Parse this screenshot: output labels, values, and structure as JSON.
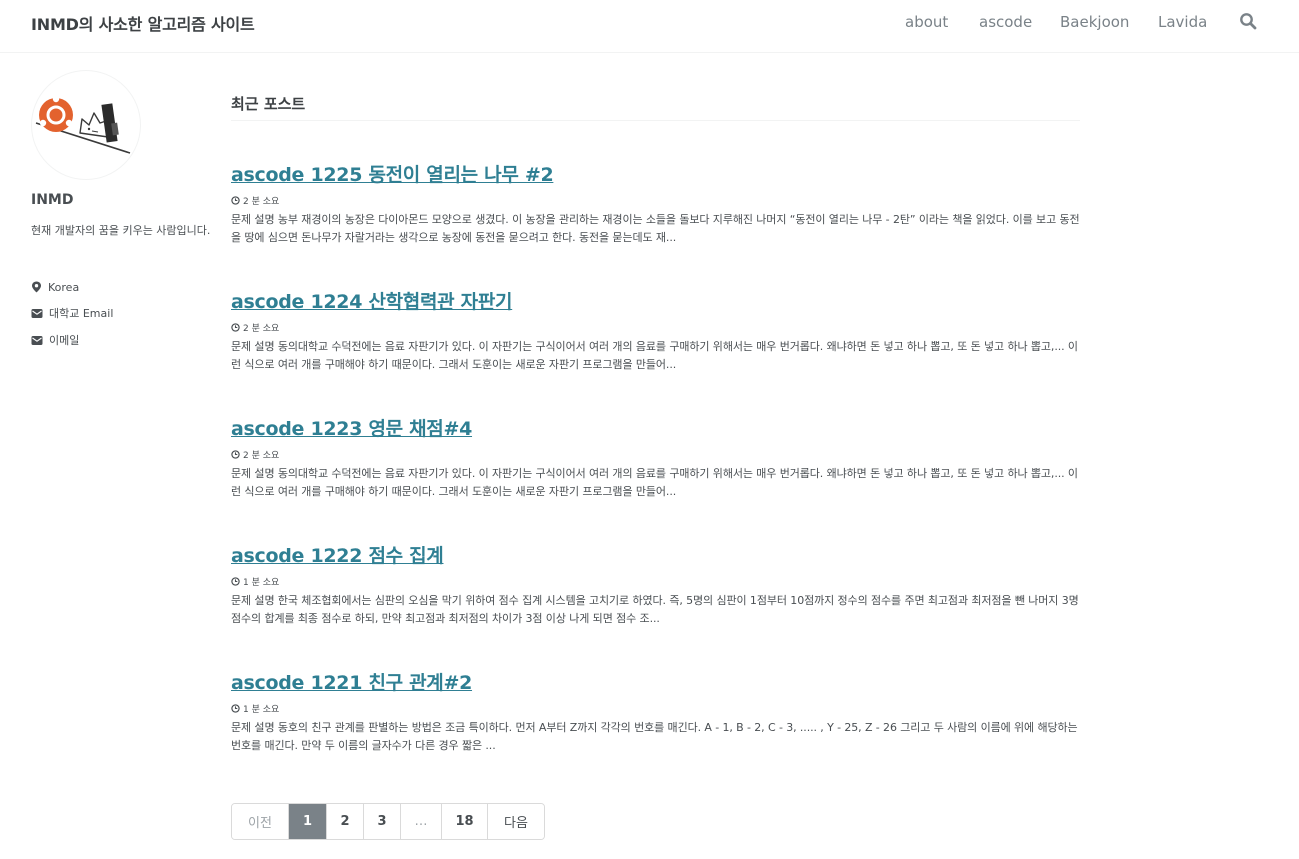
{
  "masthead": {
    "site_title": "INMD의 사소한 알고리즘 사이트",
    "nav": [
      "about",
      "ascode",
      "Baekjoon",
      "Lavida"
    ]
  },
  "sidebar": {
    "author_name": "INMD",
    "bio": "현재 개발자의 꿈을 키우는 사람입니다.",
    "links": [
      "Korea",
      "대학교 Email",
      "이메일"
    ]
  },
  "main": {
    "page_title": "최근 포스트",
    "posts": [
      {
        "title": "ascode 1225 동전이 열리는 나무 #2",
        "read_time": "2 분 소요",
        "excerpt": "문제 설명 농부 재경이의 농장은 다이아몬드 모양으로 생겼다. 이 농장을 관리하는 재경이는 소들을 돌보다 지루해진 나머지 “동전이 열리는 나무 - 2탄” 이라는 책을 읽었다. 이를 보고 동전을 땅에 심으면 돈나무가 자랄거라는 생각으로 농장에 동전을 묻으려고 한다. 동전을 묻는데도 재..."
      },
      {
        "title": "ascode 1224 산학협력관 자판기",
        "read_time": "2 분 소요",
        "excerpt": "문제 설명 동의대학교 수덕전에는 음료 자판기가 있다. 이 자판기는 구식이어서 여러 개의 음료를 구매하기 위해서는 매우 번거롭다. 왜냐하면 돈 넣고 하나 뽑고, 또 돈 넣고 하나 뽑고,... 이런 식으로 여러 개를 구매해야 하기 때문이다. 그래서 도훈이는 새로운 자판기 프로그램을 만들어..."
      },
      {
        "title": "ascode 1223 영문 채점#4",
        "read_time": "2 분 소요",
        "excerpt": "문제 설명 동의대학교 수덕전에는 음료 자판기가 있다. 이 자판기는 구식이어서 여러 개의 음료를 구매하기 위해서는 매우 번거롭다. 왜냐하면 돈 넣고 하나 뽑고, 또 돈 넣고 하나 뽑고,... 이런 식으로 여러 개를 구매해야 하기 때문이다. 그래서 도훈이는 새로운 자판기 프로그램을 만들어..."
      },
      {
        "title": "ascode 1222 점수 집계",
        "read_time": "1 분 소요",
        "excerpt": "문제 설명 한국 체조협회에서는 심판의 오심을 막기 위하여 점수 집계 시스템을 고치기로 하였다. 즉, 5명의 심판이 1점부터 10점까지 정수의 점수를 주면 최고점과 최저점을 뺀 나머지 3명 점수의 합계를 최종 점수로 하되, 만약 최고점과 최저점의 차이가 3점 이상 나게 되면 점수 조..."
      },
      {
        "title": "ascode 1221 친구 관계#2",
        "read_time": "1 분 소요",
        "excerpt": "문제 설명 동호의 친구 관계를 판별하는 방법은 조금 특이하다. 먼저 A부터 Z까지 각각의 번호를 매긴다. A - 1, B - 2, C - 3, ..... , Y - 25, Z - 26 그리고 두 사람의 이름에 위에 해당하는 번호를 매긴다. 만약 두 이름의 글자수가 다른 경우 짧은 ..."
      }
    ]
  },
  "pagination": {
    "prev": "이전",
    "pages": [
      "1",
      "2",
      "3",
      "…",
      "18"
    ],
    "next": "다음",
    "current": "1"
  }
}
